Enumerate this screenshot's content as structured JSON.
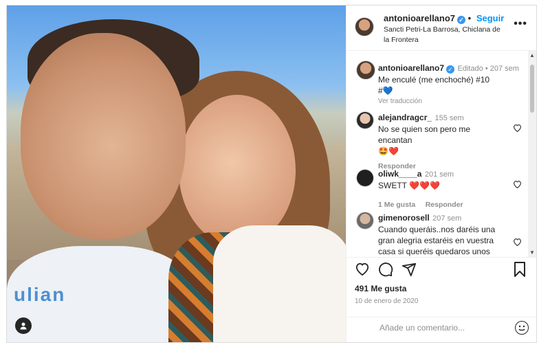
{
  "post": {
    "username": "antonioarellano7",
    "verified_mark": "✓",
    "follow_label": "Seguir",
    "location": "Sancti Petri-La Barrosa, Chiclana de la Frontera",
    "more_label": "•••",
    "photo_print_text": "ulian"
  },
  "caption": {
    "username": "antonioarellano7",
    "edited": "Editado",
    "time": "207 sem",
    "text": "Me enculé (me enchoché) #10",
    "tag": "#💙",
    "translate": "Ver traducción"
  },
  "comments": [
    {
      "username": "alejandragcr_",
      "time": "155 sem",
      "text": "No se quien son pero me encantan",
      "emoji": "🤩❤️",
      "reply": "Responder"
    },
    {
      "username": "oliwk____a",
      "time": "201 sem",
      "text": "SWETT ❤️❤️❤️",
      "likes": "1 Me gusta",
      "reply": "Responder"
    },
    {
      "username": "gimenorosell",
      "time": "207 sem",
      "text": "Cuando queráis..nos daréis una gran alegria estaréis en vuestra casa si queréis quedaros unos días. 👍"
    }
  ],
  "stats": {
    "likes": "491 Me gusta",
    "date": "10 de enero de 2020"
  },
  "composer": {
    "placeholder": "Añade un comentario..."
  },
  "icons": [
    "heart-icon",
    "comment-icon",
    "share-icon",
    "bookmark-icon",
    "emoji-icon",
    "more-icon",
    "user-tag-icon"
  ],
  "colors": {
    "link_blue": "#0095f6",
    "verified_blue": "#3897f0",
    "muted": "#8e8e8e",
    "heart_red": "#ed4956"
  }
}
